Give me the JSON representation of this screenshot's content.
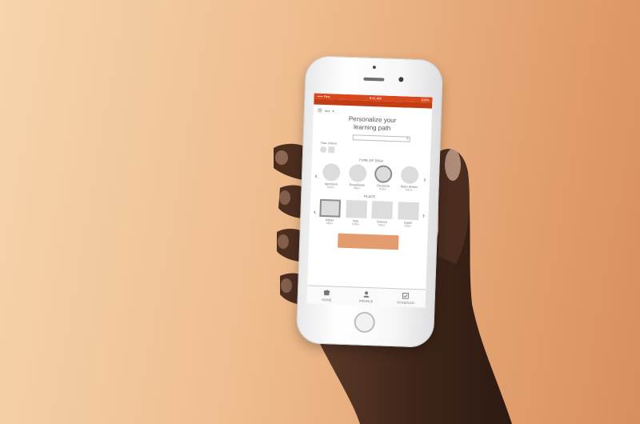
{
  "status": {
    "carrier": "••••• Fine",
    "time": "8:41 AM",
    "battery": "100%"
  },
  "user": {
    "name": "Irini"
  },
  "page": {
    "title_line1": "Personalize your",
    "title_line2": "learning path"
  },
  "choice": {
    "label": "Your choice"
  },
  "sections": {
    "dish": "TYPE OF DISH",
    "place": "PLACE"
  },
  "dishes": [
    {
      "label": "Apetizers",
      "info": "Info+",
      "selected": false
    },
    {
      "label": "Breakfasts",
      "info": "Info+",
      "selected": false
    },
    {
      "label": "Desserts",
      "info": "Info+",
      "selected": true
    },
    {
      "label": "Main dishes",
      "info": "Info+",
      "selected": false
    }
  ],
  "places": [
    {
      "label": "Indian",
      "info": "Info+",
      "selected": true
    },
    {
      "label": "Italy",
      "info": "Info+",
      "selected": false
    },
    {
      "label": "Greece",
      "info": "Info+",
      "selected": false
    },
    {
      "label": "Spain",
      "info": "Info+",
      "selected": false
    }
  ],
  "tabs": [
    {
      "label": "HOME",
      "icon": "chef-hat-icon"
    },
    {
      "label": "PROFILE",
      "icon": "person-icon"
    },
    {
      "label": "SCHEDULE",
      "icon": "calendar-check-icon"
    }
  ],
  "colors": {
    "accent": "#d9481c",
    "cta": "#e49b6d"
  }
}
